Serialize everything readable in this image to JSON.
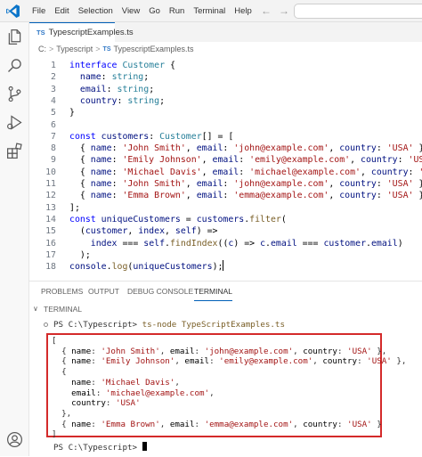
{
  "menu": [
    "File",
    "Edit",
    "Selection",
    "View",
    "Go",
    "Run",
    "Terminal",
    "Help"
  ],
  "nav": {
    "back": "←",
    "forward": "→"
  },
  "tab": {
    "badge": "TS",
    "label": "TypescriptExamples.ts"
  },
  "breadcrumb": {
    "path": [
      "C:",
      "Typescript"
    ],
    "separator": ">",
    "file_badge": "TS",
    "file": "TypescriptExamples.ts"
  },
  "editor": {
    "lines": [
      {
        "n": "1",
        "tokens": [
          [
            "kw",
            "interface "
          ],
          [
            "ty",
            "Customer"
          ],
          [
            "pn",
            " {"
          ]
        ]
      },
      {
        "n": "2",
        "tokens": [
          [
            "pn",
            "  "
          ],
          [
            "pr",
            "name"
          ],
          [
            "pn",
            ": "
          ],
          [
            "ty",
            "string"
          ],
          [
            "pn",
            ";"
          ]
        ]
      },
      {
        "n": "3",
        "tokens": [
          [
            "pn",
            "  "
          ],
          [
            "pr",
            "email"
          ],
          [
            "pn",
            ": "
          ],
          [
            "ty",
            "string"
          ],
          [
            "pn",
            ";"
          ]
        ]
      },
      {
        "n": "4",
        "tokens": [
          [
            "pn",
            "  "
          ],
          [
            "pr",
            "country"
          ],
          [
            "pn",
            ": "
          ],
          [
            "ty",
            "string"
          ],
          [
            "pn",
            ";"
          ]
        ]
      },
      {
        "n": "5",
        "tokens": [
          [
            "pn",
            "}"
          ]
        ]
      },
      {
        "n": "6",
        "tokens": []
      },
      {
        "n": "7",
        "tokens": [
          [
            "kw",
            "const "
          ],
          [
            "pr",
            "customers"
          ],
          [
            "pn",
            ": "
          ],
          [
            "ty",
            "Customer"
          ],
          [
            "pn",
            "[] = ["
          ]
        ]
      },
      {
        "n": "8",
        "tokens": [
          [
            "pn",
            "  { "
          ],
          [
            "pr",
            "name"
          ],
          [
            "pn",
            ": "
          ],
          [
            "st",
            "'John Smith'"
          ],
          [
            "pn",
            ", "
          ],
          [
            "pr",
            "email"
          ],
          [
            "pn",
            ": "
          ],
          [
            "st",
            "'john@example.com'"
          ],
          [
            "pn",
            ", "
          ],
          [
            "pr",
            "country"
          ],
          [
            "pn",
            ": "
          ],
          [
            "st",
            "'USA'"
          ],
          [
            "pn",
            " },"
          ]
        ]
      },
      {
        "n": "9",
        "tokens": [
          [
            "pn",
            "  { "
          ],
          [
            "pr",
            "name"
          ],
          [
            "pn",
            ": "
          ],
          [
            "st",
            "'Emily Johnson'"
          ],
          [
            "pn",
            ", "
          ],
          [
            "pr",
            "email"
          ],
          [
            "pn",
            ": "
          ],
          [
            "st",
            "'emily@example.com'"
          ],
          [
            "pn",
            ", "
          ],
          [
            "pr",
            "country"
          ],
          [
            "pn",
            ": "
          ],
          [
            "st",
            "'USA'"
          ],
          [
            "pn",
            " },"
          ]
        ]
      },
      {
        "n": "10",
        "tokens": [
          [
            "pn",
            "  { "
          ],
          [
            "pr",
            "name"
          ],
          [
            "pn",
            ": "
          ],
          [
            "st",
            "'Michael Davis'"
          ],
          [
            "pn",
            ", "
          ],
          [
            "pr",
            "email"
          ],
          [
            "pn",
            ": "
          ],
          [
            "st",
            "'michael@example.com'"
          ],
          [
            "pn",
            ", "
          ],
          [
            "pr",
            "country"
          ],
          [
            "pn",
            ": "
          ],
          [
            "st",
            "'USA'"
          ],
          [
            "pn",
            " },"
          ]
        ]
      },
      {
        "n": "11",
        "tokens": [
          [
            "pn",
            "  { "
          ],
          [
            "pr",
            "name"
          ],
          [
            "pn",
            ": "
          ],
          [
            "st",
            "'John Smith'"
          ],
          [
            "pn",
            ", "
          ],
          [
            "pr",
            "email"
          ],
          [
            "pn",
            ": "
          ],
          [
            "st",
            "'john@example.com'"
          ],
          [
            "pn",
            ", "
          ],
          [
            "pr",
            "country"
          ],
          [
            "pn",
            ": "
          ],
          [
            "st",
            "'USA'"
          ],
          [
            "pn",
            " },"
          ]
        ]
      },
      {
        "n": "12",
        "tokens": [
          [
            "pn",
            "  { "
          ],
          [
            "pr",
            "name"
          ],
          [
            "pn",
            ": "
          ],
          [
            "st",
            "'Emma Brown'"
          ],
          [
            "pn",
            ", "
          ],
          [
            "pr",
            "email"
          ],
          [
            "pn",
            ": "
          ],
          [
            "st",
            "'emma@example.com'"
          ],
          [
            "pn",
            ", "
          ],
          [
            "pr",
            "country"
          ],
          [
            "pn",
            ": "
          ],
          [
            "st",
            "'USA'"
          ],
          [
            "pn",
            " }"
          ]
        ]
      },
      {
        "n": "13",
        "tokens": [
          [
            "pn",
            "];"
          ]
        ]
      },
      {
        "n": "14",
        "tokens": [
          [
            "kw",
            "const "
          ],
          [
            "pr",
            "uniqueCustomers"
          ],
          [
            "pn",
            " = "
          ],
          [
            "pr",
            "customers"
          ],
          [
            "pn",
            "."
          ],
          [
            "fn",
            "filter"
          ],
          [
            "pn",
            "("
          ]
        ]
      },
      {
        "n": "15",
        "tokens": [
          [
            "pn",
            "  ("
          ],
          [
            "pr",
            "customer"
          ],
          [
            "pn",
            ", "
          ],
          [
            "pr",
            "index"
          ],
          [
            "pn",
            ", "
          ],
          [
            "pr",
            "self"
          ],
          [
            "pn",
            ") =>"
          ]
        ]
      },
      {
        "n": "16",
        "tokens": [
          [
            "pn",
            "    "
          ],
          [
            "pr",
            "index"
          ],
          [
            "pn",
            " === "
          ],
          [
            "pr",
            "self"
          ],
          [
            "pn",
            "."
          ],
          [
            "fn",
            "findIndex"
          ],
          [
            "pn",
            "(("
          ],
          [
            "pr",
            "c"
          ],
          [
            "pn",
            ") => "
          ],
          [
            "pr",
            "c"
          ],
          [
            "pn",
            "."
          ],
          [
            "pr",
            "email"
          ],
          [
            "pn",
            " === "
          ],
          [
            "pr",
            "customer"
          ],
          [
            "pn",
            "."
          ],
          [
            "pr",
            "email"
          ],
          [
            "pn",
            ")"
          ]
        ]
      },
      {
        "n": "17",
        "tokens": [
          [
            "pn",
            "  );"
          ]
        ]
      },
      {
        "n": "18",
        "tokens": [
          [
            "pr",
            "console"
          ],
          [
            "pn",
            "."
          ],
          [
            "fn",
            "log"
          ],
          [
            "pn",
            "("
          ],
          [
            "pr",
            "uniqueCustomers"
          ],
          [
            "pn",
            ");"
          ]
        ]
      }
    ]
  },
  "panel": {
    "tabs": [
      "PROBLEMS",
      "OUTPUT",
      "DEBUG CONSOLE",
      "TERMINAL"
    ],
    "active_tab": "TERMINAL",
    "terminal_header": "TERMINAL",
    "chevron": "∨"
  },
  "terminal": {
    "prompt": "PS C:\\Typescript>",
    "command": "ts-node TypeScriptExamples.ts",
    "output": [
      [
        [
          "pn",
          "["
        ]
      ],
      [
        [
          "pn",
          "  { "
        ],
        [
          "pr",
          "name"
        ],
        [
          "pn",
          ": "
        ],
        [
          "st",
          "'John Smith'"
        ],
        [
          "pn",
          ", "
        ],
        [
          "pr",
          "email"
        ],
        [
          "pn",
          ": "
        ],
        [
          "st",
          "'john@example.com'"
        ],
        [
          "pn",
          ", "
        ],
        [
          "pr",
          "country"
        ],
        [
          "pn",
          ": "
        ],
        [
          "st",
          "'USA'"
        ],
        [
          "pn",
          " },"
        ]
      ],
      [
        [
          "pn",
          "  { "
        ],
        [
          "pr",
          "name"
        ],
        [
          "pn",
          ": "
        ],
        [
          "st",
          "'Emily Johnson'"
        ],
        [
          "pn",
          ", "
        ],
        [
          "pr",
          "email"
        ],
        [
          "pn",
          ": "
        ],
        [
          "st",
          "'emily@example.com'"
        ],
        [
          "pn",
          ", "
        ],
        [
          "pr",
          "country"
        ],
        [
          "pn",
          ": "
        ],
        [
          "st",
          "'USA'"
        ],
        [
          "pn",
          " },"
        ]
      ],
      [
        [
          "pn",
          "  {"
        ]
      ],
      [
        [
          "pn",
          "    "
        ],
        [
          "pr",
          "name"
        ],
        [
          "pn",
          ": "
        ],
        [
          "st",
          "'Michael Davis'"
        ],
        [
          "pn",
          ","
        ]
      ],
      [
        [
          "pn",
          "    "
        ],
        [
          "pr",
          "email"
        ],
        [
          "pn",
          ": "
        ],
        [
          "st",
          "'michael@example.com'"
        ],
        [
          "pn",
          ","
        ]
      ],
      [
        [
          "pn",
          "    "
        ],
        [
          "pr",
          "country"
        ],
        [
          "pn",
          ": "
        ],
        [
          "st",
          "'USA'"
        ]
      ],
      [
        [
          "pn",
          "  },"
        ]
      ],
      [
        [
          "pn",
          "  { "
        ],
        [
          "pr",
          "name"
        ],
        [
          "pn",
          ": "
        ],
        [
          "st",
          "'Emma Brown'"
        ],
        [
          "pn",
          ", "
        ],
        [
          "pr",
          "email"
        ],
        [
          "pn",
          ": "
        ],
        [
          "st",
          "'emma@example.com'"
        ],
        [
          "pn",
          ", "
        ],
        [
          "pr",
          "country"
        ],
        [
          "pn",
          ": "
        ],
        [
          "st",
          "'USA'"
        ],
        [
          "pn",
          " }"
        ]
      ],
      [
        [
          "pn",
          "]"
        ]
      ]
    ],
    "final_prompt": "PS C:\\Typescript>"
  },
  "colors": {
    "accent": "#005fb8",
    "highlight_box": "#d42a2a",
    "keyword": "#0000ff",
    "type": "#267f99",
    "string": "#a31515"
  },
  "icons": {
    "activity": [
      "explorer-icon",
      "search-icon",
      "source-control-icon",
      "run-debug-icon",
      "extensions-icon",
      "account-icon"
    ]
  }
}
